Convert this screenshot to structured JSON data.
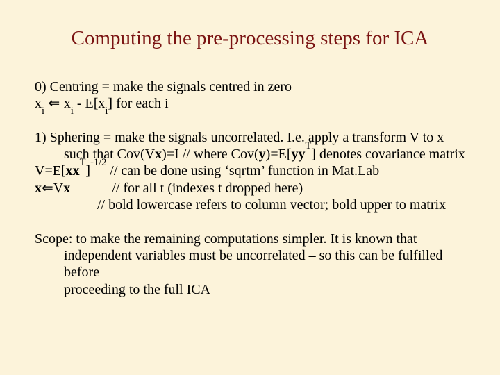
{
  "title": "Computing the pre-processing steps for ICA",
  "block0": {
    "l1a": "0) Centring = make the signals centred in zero",
    "l2_x1": "x",
    "l2_i1": "i",
    "l2_arrow": " ⇐ ",
    "l2_x2": "x",
    "l2_i2": "i",
    "l2_mid": " - E[x",
    "l2_i3": "i",
    "l2_end": "] for each i"
  },
  "block1": {
    "l1": "1) Sphering = make the signals uncorrelated. I.e. apply a transform V to x",
    "l2a": "such that Cov(V",
    "l2b": "x",
    "l2c": ")=I   // where Cov(",
    "l2d": "y",
    "l2e": ")=E[",
    "l2f": "y",
    "l2g": "y",
    "l2h": "T",
    "l2i": "] denotes covariance matrix",
    "l3a": "V=E[",
    "l3b": "x",
    "l3c": "x",
    "l3d": "T",
    "l3e": "]",
    "l3f": "-1/2",
    "l3g": "   // can be done using ‘sqrtm’ function in Mat.Lab",
    "l4a": "x",
    "l4arr": "⇐",
    "l4b": "V",
    "l4c": "x",
    "l4d": "            // for all t (indexes t dropped here)",
    "l5": "// bold lowercase refers to column vector; bold upper to matrix"
  },
  "block2": {
    "l1": "Scope: to make the remaining computations simpler. It is known that",
    "l2": "independent variables must be uncorrelated – so this can be fulfilled before",
    "l3": "proceeding to the full ICA"
  }
}
